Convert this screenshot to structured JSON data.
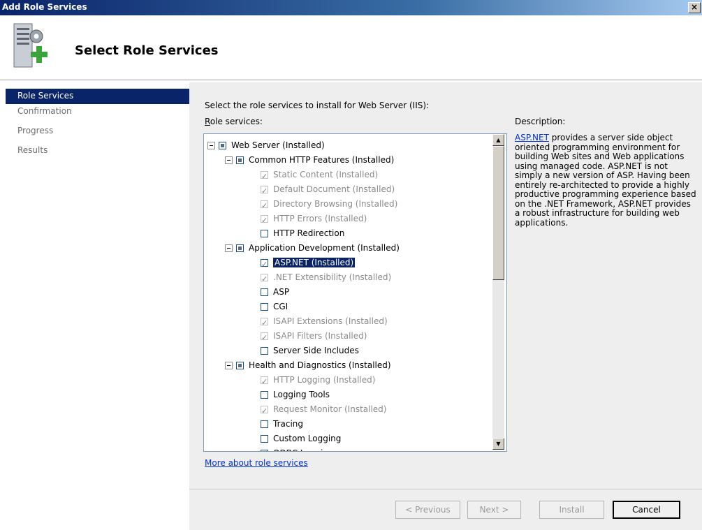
{
  "window": {
    "title": "Add Role Services",
    "close_glyph": "×"
  },
  "header": {
    "title": "Select Role Services",
    "icon": "server-add-icon"
  },
  "nav": {
    "items": [
      {
        "label": "Role Services",
        "selected": true
      },
      {
        "label": "Confirmation",
        "selected": false
      },
      {
        "label": "Progress",
        "selected": false
      },
      {
        "label": "Results",
        "selected": false
      }
    ]
  },
  "main": {
    "intro": "Select the role services to install for Web Server (IIS):",
    "role_services_label": "Role services:",
    "role_services_accel": "R",
    "role_services_rest": "ole services:",
    "description_label": "Description:",
    "description_link": "ASP.NET",
    "description_text": " provides a server side object oriented programming environment for building Web sites and Web applications using managed code. ASP.NET is not simply a new version of ASP. Having been entirely re-architected to provide a highly productive programming experience based on the .NET Framework, ASP.NET provides a robust infrastructure for building web applications.",
    "more_link": "More about role services"
  },
  "tree": [
    {
      "label": "Web Server  (Installed)",
      "level": 0,
      "expander": true,
      "check": "indet",
      "disabled": false,
      "selected": false
    },
    {
      "label": "Common HTTP Features  (Installed)",
      "level": 1,
      "expander": true,
      "check": "indet",
      "disabled": false,
      "selected": false
    },
    {
      "label": "Static Content  (Installed)",
      "level": 2,
      "expander": false,
      "check": "checked",
      "disabled": true,
      "selected": false
    },
    {
      "label": "Default Document  (Installed)",
      "level": 2,
      "expander": false,
      "check": "checked",
      "disabled": true,
      "selected": false
    },
    {
      "label": "Directory Browsing  (Installed)",
      "level": 2,
      "expander": false,
      "check": "checked",
      "disabled": true,
      "selected": false
    },
    {
      "label": "HTTP Errors  (Installed)",
      "level": 2,
      "expander": false,
      "check": "checked",
      "disabled": true,
      "selected": false
    },
    {
      "label": "HTTP Redirection",
      "level": 2,
      "expander": false,
      "check": "unchecked",
      "disabled": false,
      "selected": false
    },
    {
      "label": "Application Development  (Installed)",
      "level": 1,
      "expander": true,
      "check": "indet",
      "disabled": false,
      "selected": false
    },
    {
      "label": "ASP.NET  (Installed)",
      "level": 2,
      "expander": false,
      "check": "checked",
      "disabled": false,
      "selected": true
    },
    {
      "label": ".NET Extensibility  (Installed)",
      "level": 2,
      "expander": false,
      "check": "checked",
      "disabled": true,
      "selected": false
    },
    {
      "label": "ASP",
      "level": 2,
      "expander": false,
      "check": "unchecked",
      "disabled": false,
      "selected": false
    },
    {
      "label": "CGI",
      "level": 2,
      "expander": false,
      "check": "unchecked",
      "disabled": false,
      "selected": false
    },
    {
      "label": "ISAPI Extensions  (Installed)",
      "level": 2,
      "expander": false,
      "check": "checked",
      "disabled": true,
      "selected": false
    },
    {
      "label": "ISAPI Filters  (Installed)",
      "level": 2,
      "expander": false,
      "check": "checked",
      "disabled": true,
      "selected": false
    },
    {
      "label": "Server Side Includes",
      "level": 2,
      "expander": false,
      "check": "unchecked",
      "disabled": false,
      "selected": false
    },
    {
      "label": "Health and Diagnostics  (Installed)",
      "level": 1,
      "expander": true,
      "check": "indet",
      "disabled": false,
      "selected": false
    },
    {
      "label": "HTTP Logging  (Installed)",
      "level": 2,
      "expander": false,
      "check": "checked",
      "disabled": true,
      "selected": false
    },
    {
      "label": "Logging Tools",
      "level": 2,
      "expander": false,
      "check": "unchecked",
      "disabled": false,
      "selected": false
    },
    {
      "label": "Request Monitor  (Installed)",
      "level": 2,
      "expander": false,
      "check": "checked",
      "disabled": true,
      "selected": false
    },
    {
      "label": "Tracing",
      "level": 2,
      "expander": false,
      "check": "unchecked",
      "disabled": false,
      "selected": false
    },
    {
      "label": "Custom Logging",
      "level": 2,
      "expander": false,
      "check": "unchecked",
      "disabled": false,
      "selected": false
    },
    {
      "label": "ODBC Logging",
      "level": 2,
      "expander": false,
      "check": "unchecked",
      "disabled": false,
      "selected": false
    }
  ],
  "buttons": {
    "previous": "< Previous",
    "next": "Next >",
    "install": "Install",
    "cancel": "Cancel"
  },
  "colors": {
    "accent": "#0a246a",
    "link": "#0033cc"
  }
}
